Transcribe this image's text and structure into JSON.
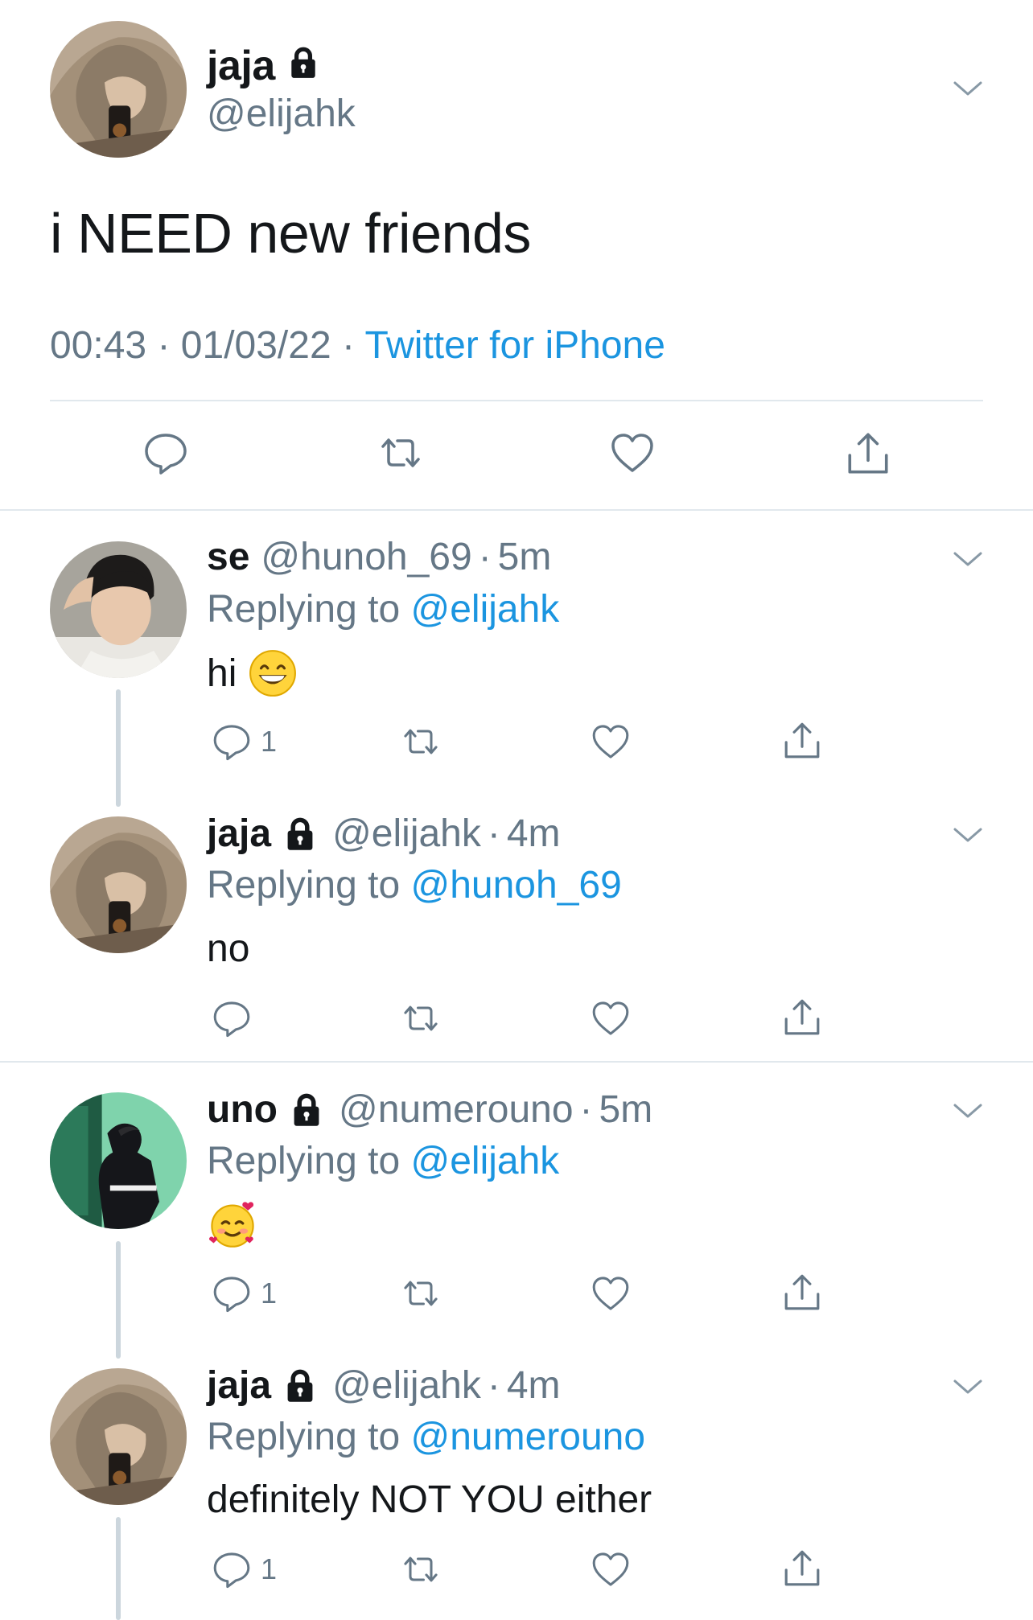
{
  "colors": {
    "text": "#14171a",
    "muted": "#657786",
    "link": "#1b95e0",
    "divider": "#e1e8ed",
    "thread_line": "#ccd6dd"
  },
  "main_tweet": {
    "display_name": "jaja",
    "handle": "@elijahk",
    "protected_icon": "lock-icon",
    "text": "i NEED new friends",
    "time": "00:43",
    "date": "01/03/22",
    "separator": "·",
    "source": "Twitter for iPhone",
    "actions": [
      "reply-icon",
      "retweet-icon",
      "like-icon",
      "share-icon"
    ]
  },
  "replies": [
    {
      "display_name": "se",
      "handle": "@hunoh_69",
      "age": "5m",
      "protected": false,
      "replying_prefix": "Replying to",
      "replying_to": "@elijahk",
      "text": "hi",
      "emoji": "grinning-face",
      "reply_count": "1"
    },
    {
      "display_name": "jaja",
      "handle": "@elijahk",
      "age": "4m",
      "protected": true,
      "replying_prefix": "Replying to",
      "replying_to": "@hunoh_69",
      "text": "no",
      "reply_count": ""
    },
    {
      "display_name": "uno",
      "handle": "@numerouno",
      "age": "5m",
      "protected": true,
      "replying_prefix": "Replying to",
      "replying_to": "@elijahk",
      "text": "",
      "emoji": "smiling-face-with-hearts",
      "reply_count": "1"
    },
    {
      "display_name": "jaja",
      "handle": "@elijahk",
      "age": "4m",
      "protected": true,
      "replying_prefix": "Replying to",
      "replying_to": "@numerouno",
      "text": "definitely NOT YOU either",
      "reply_count": "1"
    }
  ]
}
